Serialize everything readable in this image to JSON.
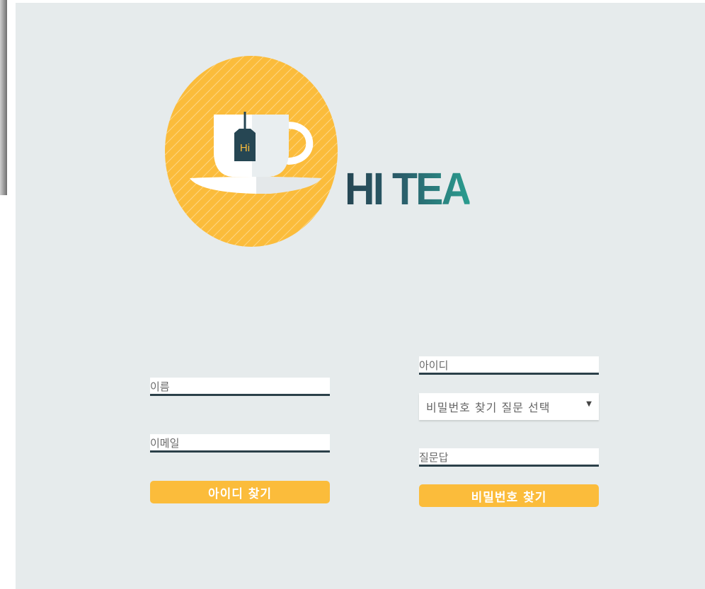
{
  "brand": {
    "name": "HI TEA",
    "tag_text": "Hi",
    "colors": {
      "circle": "#fbbc3b",
      "text_dark": "#264653",
      "text_teal": "#2a9d8f",
      "cup": "#ffffff",
      "tag": "#264653"
    }
  },
  "find_id": {
    "name_placeholder": "이름",
    "email_placeholder": "이메일",
    "submit_label": "아이디 찾기"
  },
  "find_password": {
    "id_placeholder": "아이디",
    "question_select": "비밀번호 찾기 질문 선택",
    "answer_placeholder": "질문답",
    "submit_label": "비밀번호 찾기"
  },
  "colors": {
    "background": "#e6ebec",
    "accent": "#fbbc3b",
    "input_border": "#2b4049"
  }
}
